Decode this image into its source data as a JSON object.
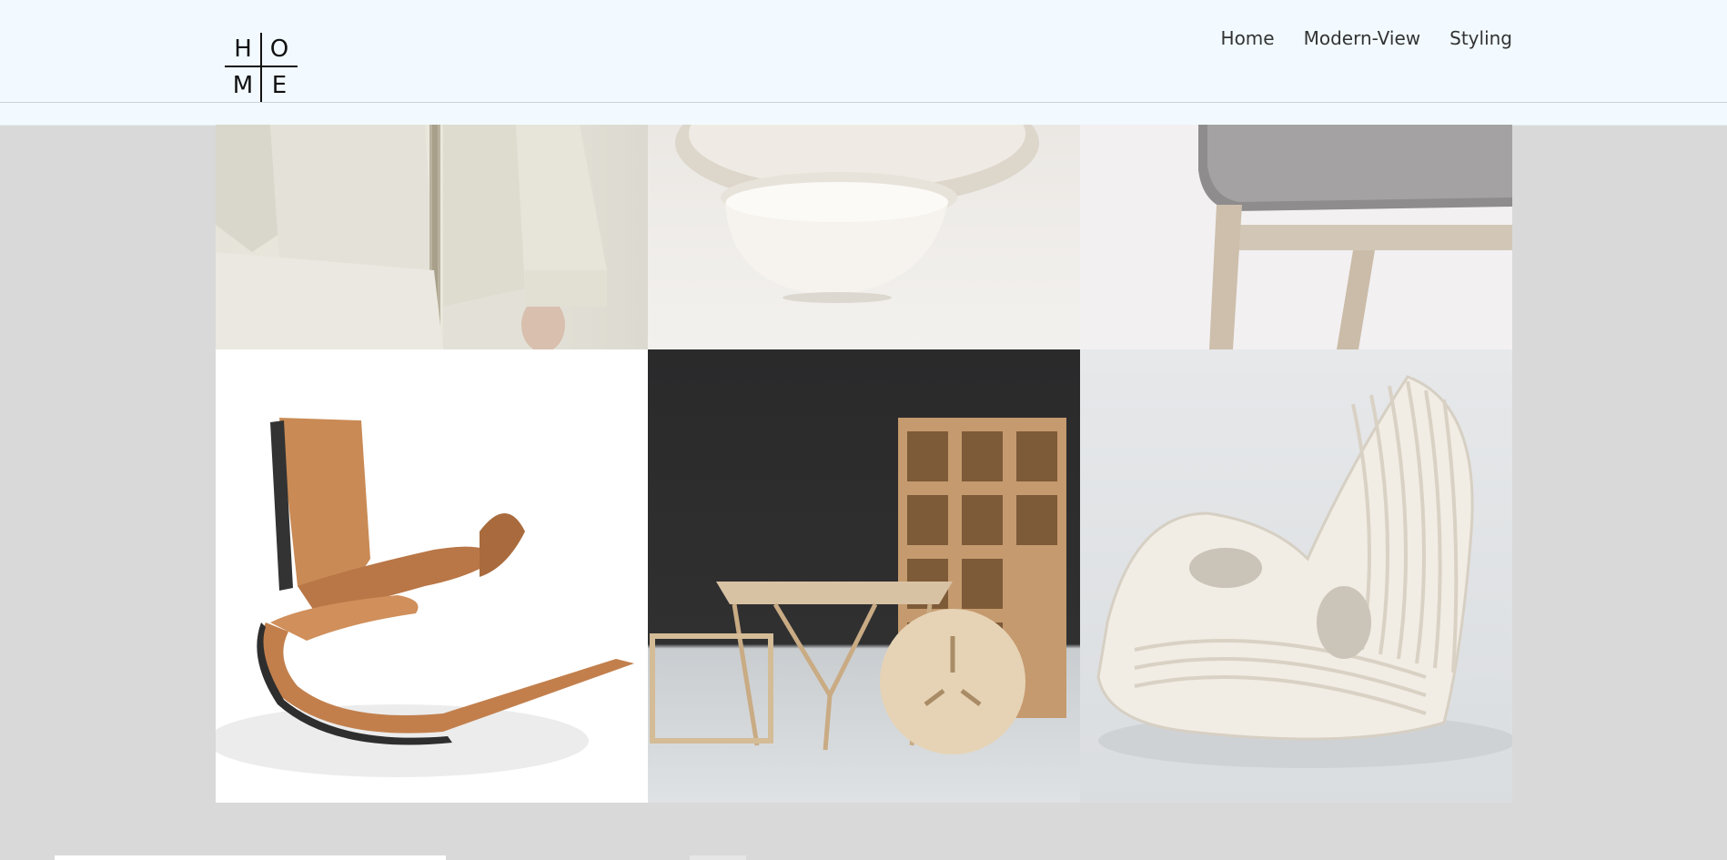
{
  "header": {
    "logo": {
      "letters": [
        "H",
        "O",
        "M",
        "E"
      ]
    },
    "nav": [
      {
        "label": "Home"
      },
      {
        "label": "Modern-View"
      },
      {
        "label": "Styling"
      }
    ]
  },
  "gallery": {
    "tiles": [
      {
        "subject": "beige-shirt-with-rope-image"
      },
      {
        "subject": "ceramic-bowl-image"
      },
      {
        "subject": "upholstered-chair-leg-image"
      },
      {
        "subject": "wooden-rocking-chair-image"
      },
      {
        "subject": "plywood-furniture-set-image"
      },
      {
        "subject": "parametric-white-rocking-chair-image"
      }
    ]
  }
}
